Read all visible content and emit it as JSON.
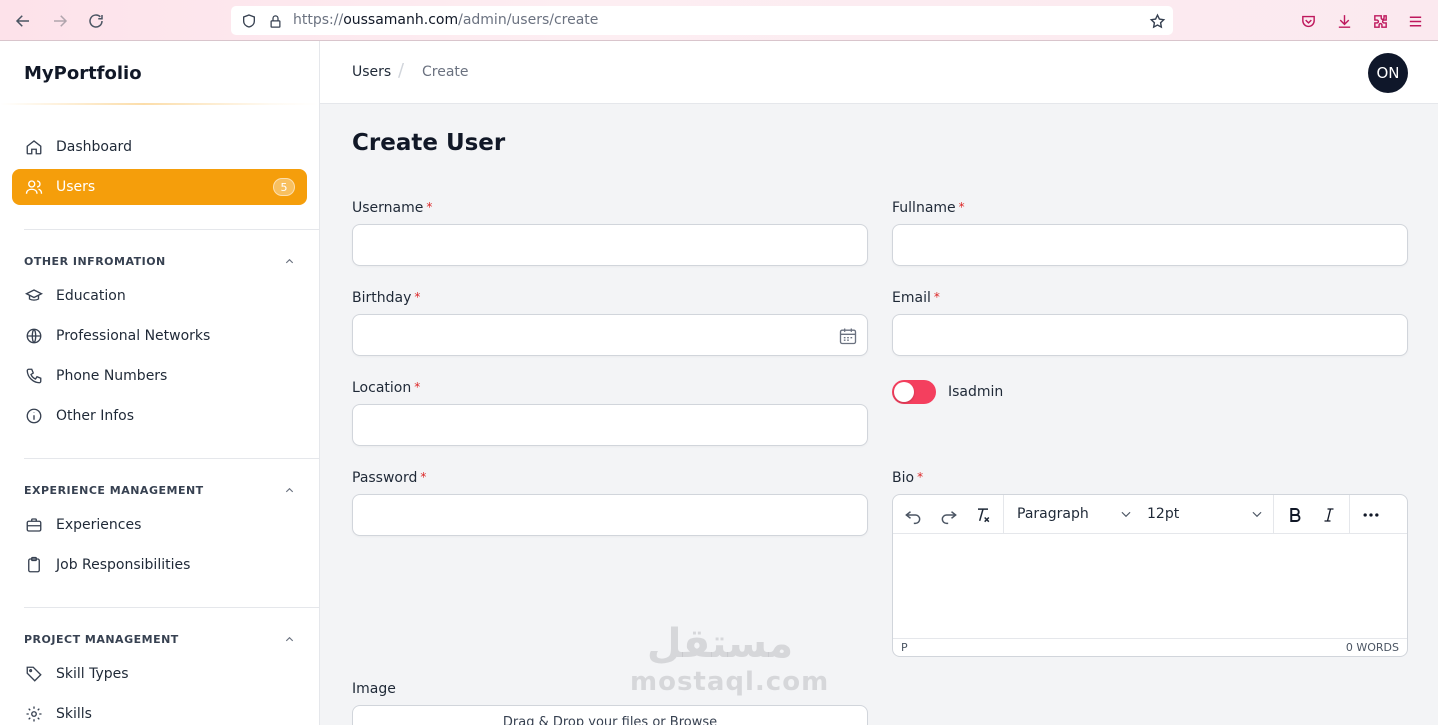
{
  "browser": {
    "url_prefix": "https://",
    "url_host": "oussamanh.com",
    "url_path": "/admin/users/create"
  },
  "sidebar": {
    "brand": "MyPortfolio",
    "top_items": [
      {
        "label": "Dashboard",
        "icon": "home-icon"
      },
      {
        "label": "Users",
        "icon": "users-icon",
        "badge": "5",
        "active": true
      }
    ],
    "groups": [
      {
        "title": "OTHER INFROMATION",
        "items": [
          {
            "label": "Education",
            "icon": "graduation-cap-icon"
          },
          {
            "label": "Professional Networks",
            "icon": "globe-icon"
          },
          {
            "label": "Phone Numbers",
            "icon": "phone-icon"
          },
          {
            "label": "Other Infos",
            "icon": "info-circle-icon"
          }
        ]
      },
      {
        "title": "EXPERIENCE MANAGEMENT",
        "items": [
          {
            "label": "Experiences",
            "icon": "briefcase-icon"
          },
          {
            "label": "Job Responsibilities",
            "icon": "clipboard-icon"
          }
        ]
      },
      {
        "title": "PROJECT MANAGEMENT",
        "items": [
          {
            "label": "Skill Types",
            "icon": "tag-icon"
          },
          {
            "label": "Skills",
            "icon": "gear-icon"
          }
        ]
      }
    ]
  },
  "header": {
    "breadcrumb": [
      "Users",
      "Create"
    ],
    "separator": "/",
    "avatar_initials": "ON"
  },
  "form": {
    "title": "Create User",
    "required_mark": "*",
    "fields": {
      "username": {
        "label": "Username",
        "value": ""
      },
      "fullname": {
        "label": "Fullname",
        "value": ""
      },
      "birthday": {
        "label": "Birthday",
        "value": ""
      },
      "email": {
        "label": "Email",
        "value": ""
      },
      "location": {
        "label": "Location",
        "value": ""
      },
      "password": {
        "label": "Password",
        "value": ""
      },
      "bio": {
        "label": "Bio"
      },
      "image": {
        "label": "Image",
        "dropzone_text": "Drag & Drop your files or Browse"
      }
    },
    "isadmin": {
      "label": "Isadmin",
      "checked": false
    }
  },
  "editor": {
    "block_format": "Paragraph",
    "font_size": "12pt",
    "status_path": "P",
    "word_count": "0 WORDS"
  },
  "watermark": {
    "arabic": "مستقل",
    "latin": "mostaql.com"
  },
  "colors": {
    "accent": "#f59e0b",
    "toggle_off": "#f43f5e",
    "required": "#dc2626",
    "avatar_bg": "#0f172a"
  }
}
